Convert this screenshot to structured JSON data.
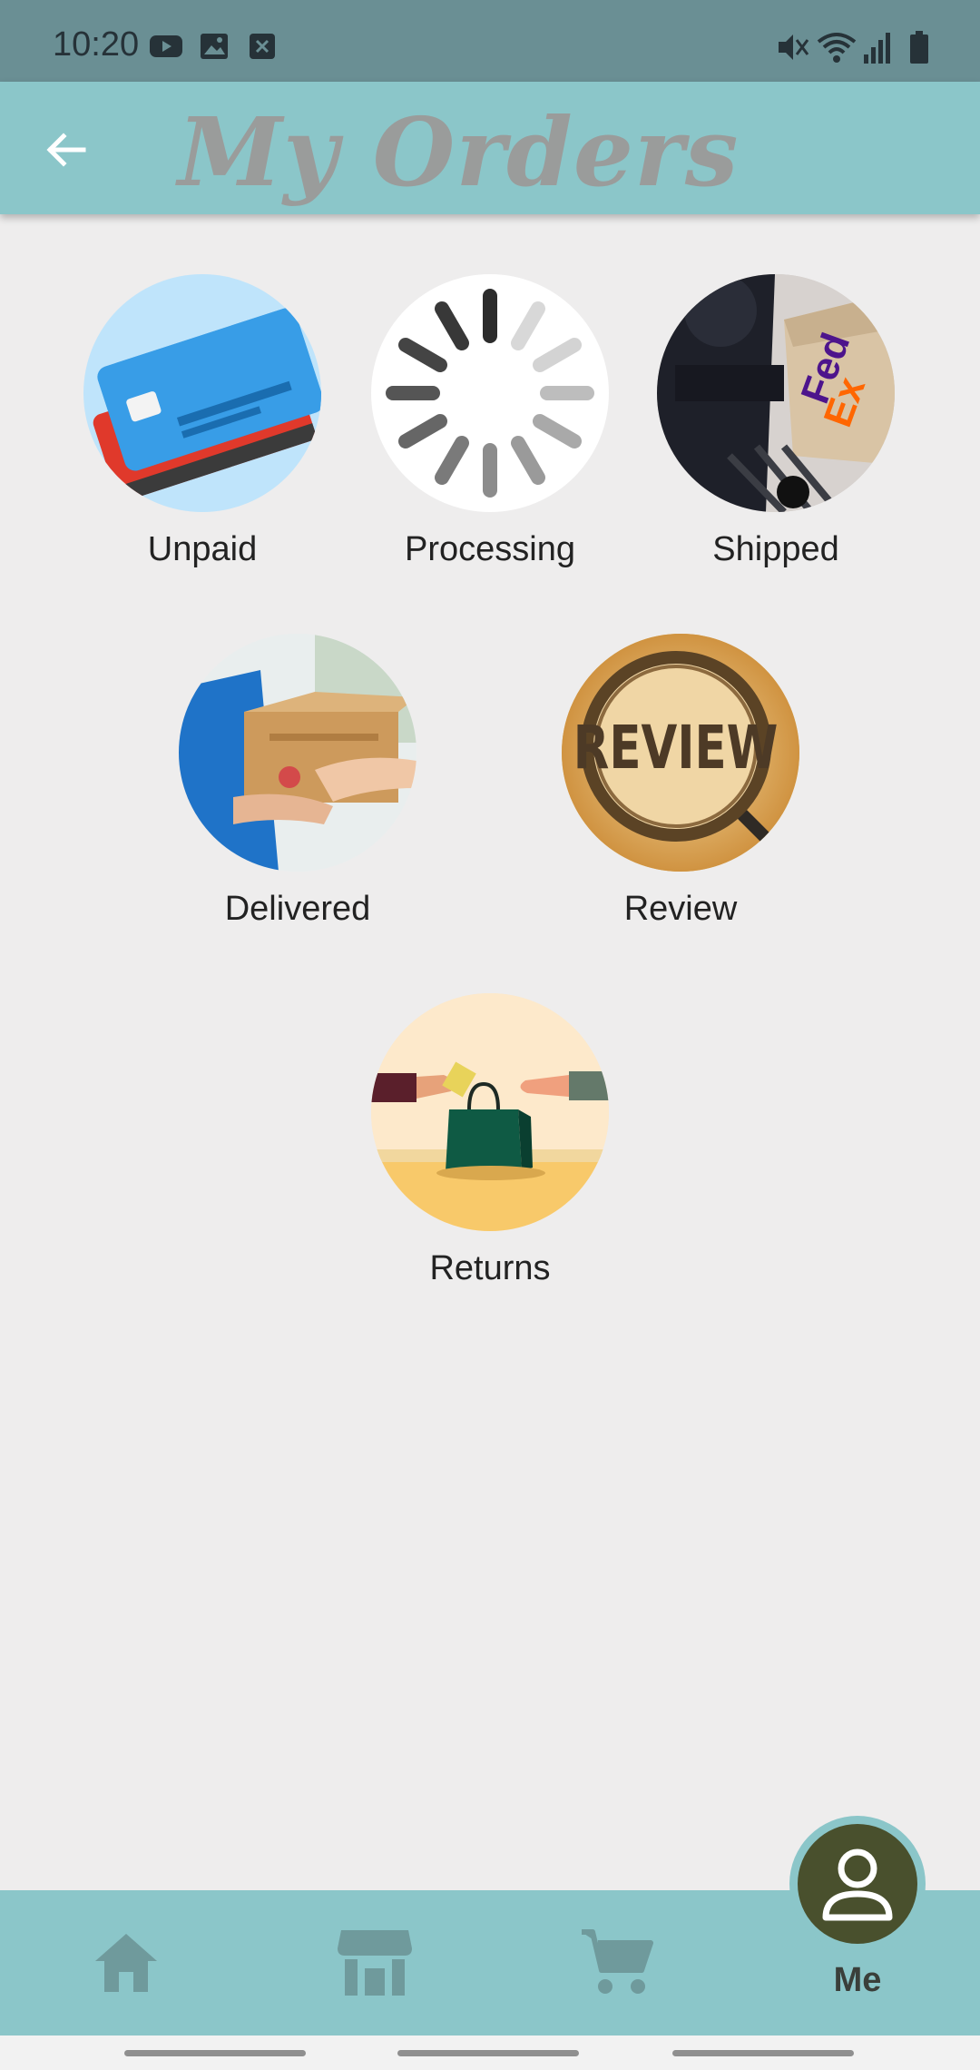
{
  "status_bar": {
    "time": "10:20",
    "left_icons": [
      "youtube-icon",
      "gallery-icon",
      "app-notification-icon"
    ],
    "right_icons": [
      "vibrate-icon",
      "wifi-icon",
      "signal-icon",
      "battery-icon"
    ]
  },
  "app_bar": {
    "back_icon": "arrow-left-icon",
    "title": "My Orders"
  },
  "categories": [
    {
      "label": "Unpaid",
      "icon": "credit-card-icon"
    },
    {
      "label": "Processing",
      "icon": "loading-spinner-icon"
    },
    {
      "label": "Shipped",
      "icon": "shipping-delivery-icon"
    },
    {
      "label": "Delivered",
      "icon": "package-handover-icon"
    },
    {
      "label": "Review",
      "icon": "review-magnifier-icon"
    },
    {
      "label": "Returns",
      "icon": "return-bag-icon"
    }
  ],
  "bottom_nav": {
    "items": [
      {
        "icon": "home-icon"
      },
      {
        "icon": "store-icon"
      },
      {
        "icon": "cart-icon"
      }
    ],
    "me_label": "Me",
    "me_icon": "person-icon"
  },
  "colors": {
    "app_bar": "#8bc6c9",
    "status_bar": "#6a8f94",
    "background": "#eeeded",
    "me_fab": "#49502d",
    "title": "#9a9c9b"
  }
}
